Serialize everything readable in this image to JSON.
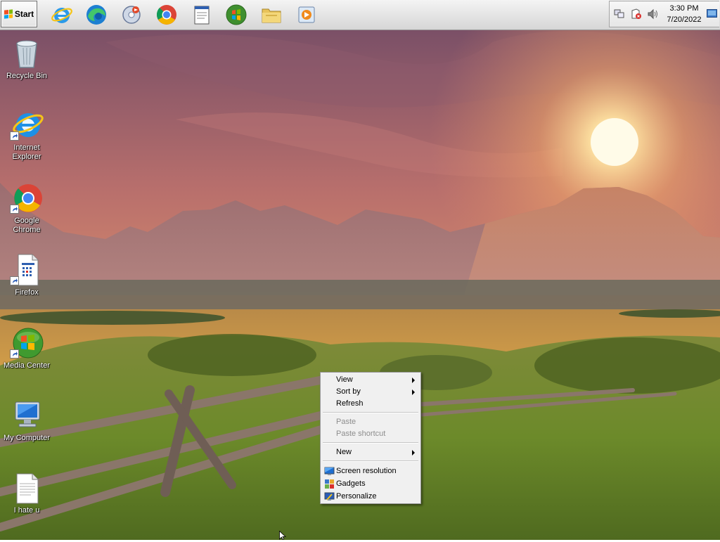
{
  "taskbar": {
    "start_label": "Start",
    "quick_launch": [
      {
        "name": "internet-explorer-icon"
      },
      {
        "name": "edge-icon"
      },
      {
        "name": "media-player-icon"
      },
      {
        "name": "chrome-icon"
      },
      {
        "name": "notepad-icon"
      },
      {
        "name": "media-center-icon"
      },
      {
        "name": "folder-icon"
      },
      {
        "name": "video-player-icon"
      }
    ],
    "tray": {
      "time": "3:30 PM",
      "date": "7/20/2022",
      "icons": [
        "network-icon",
        "action-center-icon",
        "volume-icon",
        "show-desktop-icon"
      ]
    }
  },
  "desktop": {
    "icons": [
      {
        "label": "Recycle Bin",
        "icon": "recycle-bin-icon"
      },
      {
        "label": "Internet\nExplorer",
        "icon": "internet-explorer-icon"
      },
      {
        "label": "Google Chrome",
        "icon": "chrome-icon"
      },
      {
        "label": "Firefox",
        "icon": "firefox-shortcut-icon"
      },
      {
        "label": "Media Center",
        "icon": "media-center-icon"
      },
      {
        "label": "My Computer",
        "icon": "computer-icon"
      },
      {
        "label": "I hate u",
        "icon": "text-file-icon"
      }
    ]
  },
  "context_menu": {
    "view": "View",
    "sort_by": "Sort by",
    "refresh": "Refresh",
    "paste": "Paste",
    "paste_shortcut": "Paste shortcut",
    "new": "New",
    "screen_resolution": "Screen resolution",
    "gadgets": "Gadgets",
    "personalize": "Personalize"
  },
  "colors": {
    "sky_top": "#8a5a72",
    "sky_glow": "#f1a56a",
    "sun": "#fff6d0",
    "mountains": "#8d6a72",
    "field": "#c99a45",
    "grass": "#6e8a2e",
    "menu_bg": "#f0f0f0"
  }
}
